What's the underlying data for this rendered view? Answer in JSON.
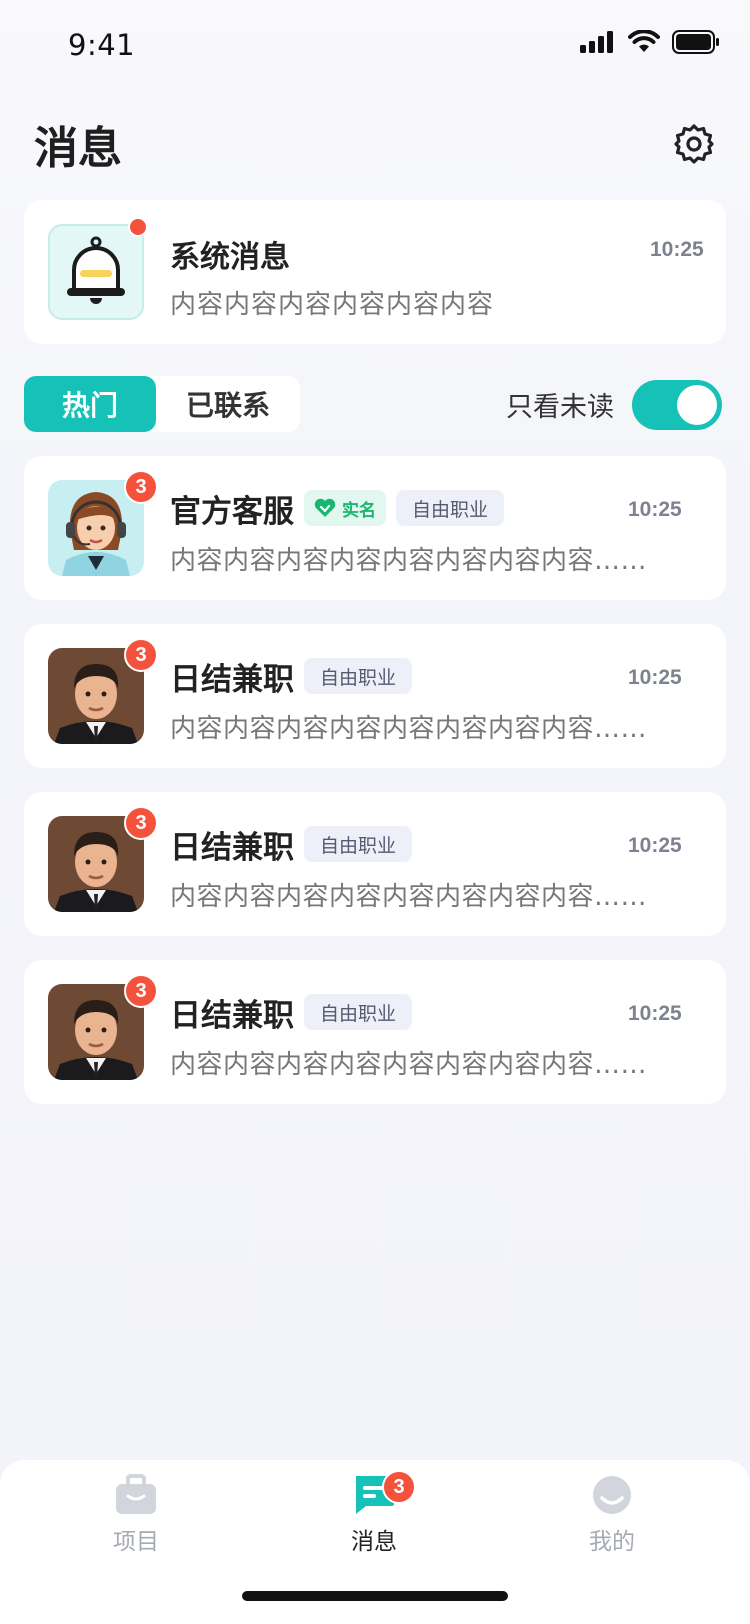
{
  "status_bar": {
    "time": "9:41"
  },
  "header": {
    "title": "消息"
  },
  "system_message": {
    "title": "系统消息",
    "time": "10:25",
    "content": "内容内容内容内容内容内容"
  },
  "tabs": [
    {
      "label": "热门",
      "active": true
    },
    {
      "label": "已联系",
      "active": false
    }
  ],
  "filter": {
    "label": "只看未读",
    "enabled": true
  },
  "chats": [
    {
      "name": "官方客服",
      "verified_label": "实名",
      "tag": "自由职业",
      "time": "10:25",
      "content": "内容内容内容内容内容内容内容内容……",
      "unread": "3",
      "avatar": "customer-service-avatar"
    },
    {
      "name": "日结兼职",
      "tag": "自由职业",
      "time": "10:25",
      "content": "内容内容内容内容内容内容内容内容……",
      "unread": "3",
      "avatar": "man-avatar"
    },
    {
      "name": "日结兼职",
      "tag": "自由职业",
      "time": "10:25",
      "content": "内容内容内容内容内容内容内容内容……",
      "unread": "3",
      "avatar": "man-avatar"
    },
    {
      "name": "日结兼职",
      "tag": "自由职业",
      "time": "10:25",
      "content": "内容内容内容内容内容内容内容内容……",
      "unread": "3",
      "avatar": "man-avatar"
    }
  ],
  "bottom_nav": [
    {
      "label": "项目",
      "icon": "briefcase-icon",
      "active": false
    },
    {
      "label": "消息",
      "icon": "chat-icon",
      "active": true,
      "badge": "3"
    },
    {
      "label": "我的",
      "icon": "profile-icon",
      "active": false
    }
  ],
  "colors": {
    "accent": "#16c1b8",
    "badge": "#f5523d",
    "verified": "#19b66f"
  }
}
